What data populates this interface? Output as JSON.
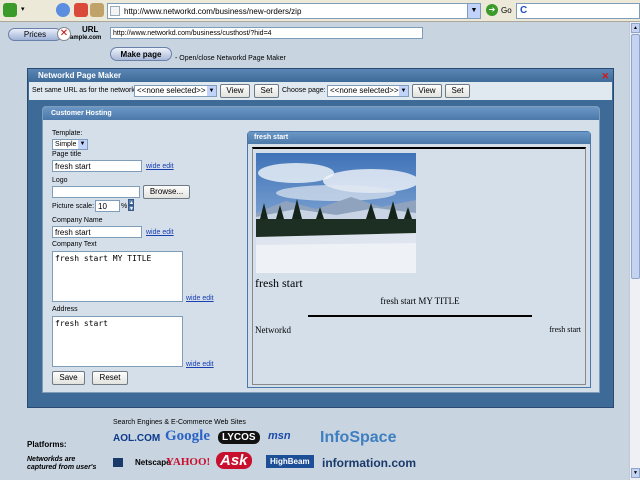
{
  "browser": {
    "address_url": "http://www.networkd.com/business/new-orders/zip",
    "go_label": "Go",
    "search_value": ""
  },
  "header": {
    "prices_label": "Prices",
    "url_label": "URL",
    "url_sublabel": "ample.com",
    "url_value": "http://www.networkd.com/business/custhost/?hid=4",
    "make_page_label": "Make page",
    "make_page_help": "- Open/close Networkd Page Maker"
  },
  "page_maker": {
    "title": "Networkd Page Maker",
    "close_glyph": "✕",
    "same_url_label": "Set same URL as for the networkd:",
    "network_select": "<<none selected>>",
    "view_label": "View",
    "set_label": "Set",
    "choose_page_label": "Choose page:",
    "page_select": "<<none selected>>"
  },
  "hosting": {
    "title": "Customer Hosting",
    "template_label": "Template:",
    "template_value": "Simple",
    "page_title_label": "Page title",
    "page_title_value": "fresh start",
    "logo_label": "Logo",
    "logo_value": "",
    "browse_label": "Browse...",
    "picture_scale_label": "Picture scale:",
    "picture_scale_value": "10",
    "percent": "%",
    "company_name_label": "Company Name",
    "company_name_value": "fresh start",
    "company_text_label": "Company Text",
    "company_text_value": "fresh start MY TITLE",
    "address_label": "Address",
    "address_value": "fresh start",
    "wide_edit": "wide edit",
    "save_label": "Save",
    "reset_label": "Reset"
  },
  "preview": {
    "title": "fresh start",
    "page_name": "fresh start",
    "company_text": "fresh start MY TITLE",
    "company": "Networkd",
    "address": "fresh start"
  },
  "footer": {
    "title": "Search Engines & E-Commerce Web Sites",
    "platforms": "Platforms:",
    "platforms_note_1": "Networkds are",
    "platforms_note_2": "captured from user's",
    "logos": [
      "AOL.COM",
      "Google",
      "LYCOS",
      "msn",
      "InfoSpace",
      "Netscape",
      "YAHOO!",
      "Ask",
      "HighBeam",
      "information.com"
    ]
  },
  "colors": {
    "panel_dark": "#3d6a97",
    "panel_light": "#d4dfea",
    "header_blue": "#4a78a8",
    "link": "#1a3fb0",
    "close_red": "#e01010"
  }
}
